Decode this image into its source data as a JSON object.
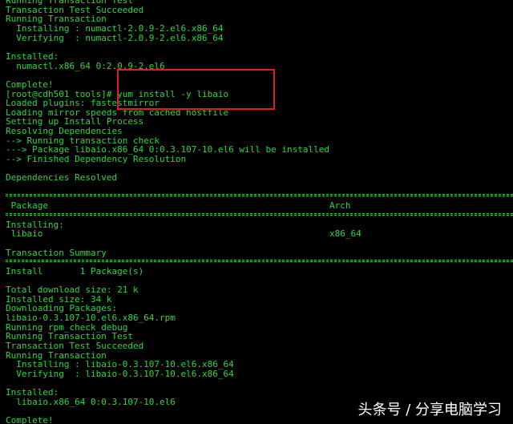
{
  "terminal": {
    "colors": {
      "background": "#000000",
      "text": "#2fd640",
      "highlight": "#e11d1d",
      "watermark": "#ffffff"
    },
    "lines": [
      "Running Transaction Test",
      "Transaction Test Succeeded",
      "Running Transaction",
      "  Installing : numactl-2.0.9-2.el6.x86_64",
      "  Verifying  : numactl-2.0.9-2.el6.x86_64",
      "",
      "Installed:",
      "  numactl.x86_64 0:2.0.9-2.el6",
      "",
      "Complete!",
      "[root@cdh501 tools]# yum install -y libaio",
      "Loaded plugins: fastestmirror",
      "Loading mirror speeds from cached hostfile",
      "Setting up Install Process",
      "Resolving Dependencies",
      "--> Running transaction check",
      "---> Package libaio.x86_64 0:0.3.107-10.el6 will be installed",
      "--> Finished Dependency Resolution",
      "",
      "Dependencies Resolved",
      "",
      "",
      " Package                                                     Arch",
      "",
      "Installing:",
      " libaio                                                      x86_64",
      "",
      "Transaction Summary",
      "",
      "Install       1 Package(s)",
      "",
      "Total download size: 21 k",
      "Installed size: 34 k",
      "Downloading Packages:",
      "libaio-0.3.107-10.el6.x86_64.rpm",
      "Running rpm_check_debug",
      "Running Transaction Test",
      "Transaction Test Succeeded",
      "Running Transaction",
      "  Installing : libaio-0.3.107-10.el6.x86_64",
      "  Verifying  : libaio-0.3.107-10.el6.x86_64",
      "",
      "Installed:",
      "  libaio.x86_64 0:0.3.107-10.el6",
      "",
      "Complete!"
    ]
  },
  "watermark": {
    "text": "头条号 / 分享电脑学习"
  }
}
